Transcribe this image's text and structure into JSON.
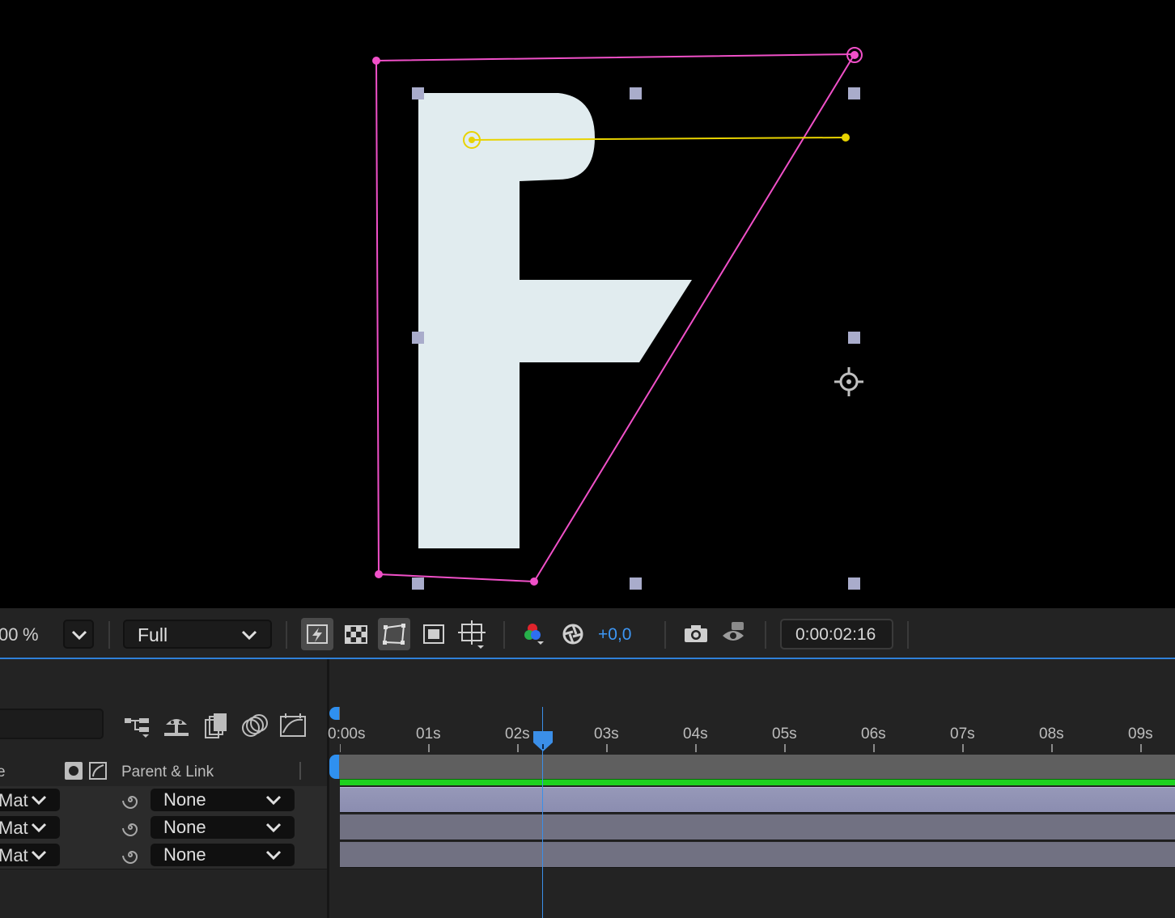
{
  "toolbar": {
    "zoom_value": "00",
    "zoom_unit": "%",
    "resolution": "Full",
    "exposure": "+0,0",
    "timecode": "0:00:02:16"
  },
  "timeline": {
    "ruler_labels": [
      "0:00s",
      "01s",
      "02s",
      "03s",
      "04s",
      "05s",
      "06s",
      "07s",
      "08s",
      "09s"
    ],
    "playhead_time": "0:00:02:16",
    "columns": {
      "name_fragment": "e",
      "parent_link": "Parent & Link"
    },
    "layers": [
      {
        "mode": "Mat",
        "parent": "None"
      },
      {
        "mode": "Mat",
        "parent": "None"
      },
      {
        "mode": "Mat",
        "parent": "None"
      }
    ]
  },
  "colors": {
    "path": "#f050c8",
    "motion_path": "#e8d300",
    "letter_fill": "#e1ecef",
    "accent_blue": "#2f90f0",
    "work_area_green": "#1ed21e",
    "layer_bar": "#76768a"
  },
  "icons": [
    "flowchart-icon",
    "shy-icon",
    "frame-blend-icon",
    "motion-blur-icon",
    "graph-editor-icon",
    "fast-preview-icon",
    "transparency-grid-icon",
    "mask-path-icon",
    "region-of-interest-icon",
    "guides-icon",
    "channel-icon",
    "exposure-icon",
    "snapshot-icon",
    "show-snapshot-icon",
    "parent-pickwhip-icon",
    "anchor-point-icon"
  ]
}
